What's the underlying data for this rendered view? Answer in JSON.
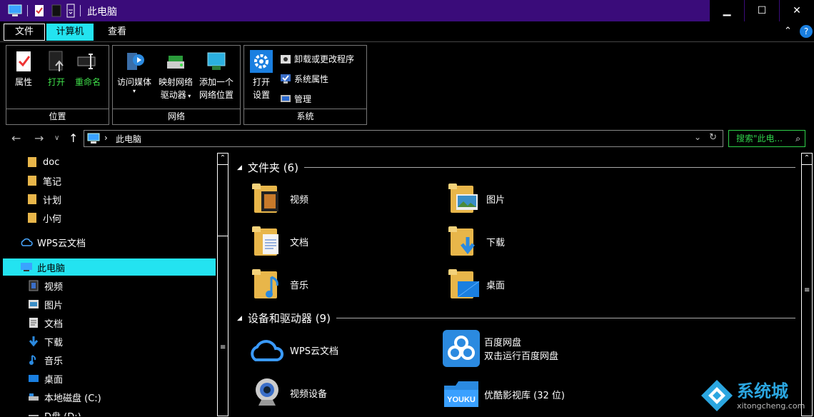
{
  "window": {
    "title": "此电脑",
    "minimize_label": "▁",
    "maximize_label": "☐",
    "close_label": "✕"
  },
  "tabs": {
    "file": "文件",
    "computer": "计算机",
    "view": "查看"
  },
  "ribbon": {
    "location": {
      "label": "位置",
      "properties": "属性",
      "open": "打开",
      "rename": "重命名"
    },
    "network": {
      "label": "网络",
      "access_media": "访问媒体",
      "map_drive_1": "映射网络",
      "map_drive_2": "驱动器",
      "add_location_1": "添加一个",
      "add_location_2": "网络位置"
    },
    "system": {
      "label": "系统",
      "open_settings_1": "打开",
      "open_settings_2": "设置",
      "uninstall": "卸载或更改程序",
      "sys_props": "系统属性",
      "manage": "管理"
    }
  },
  "address": {
    "path": "此电脑",
    "search_placeholder": "搜索\"此电..."
  },
  "sidebar": {
    "items": [
      {
        "label": "doc",
        "icon": "folder-icon"
      },
      {
        "label": "笔记",
        "icon": "folder-icon"
      },
      {
        "label": "计划",
        "icon": "folder-icon"
      },
      {
        "label": "小何",
        "icon": "folder-icon"
      },
      {
        "label": "WPS云文档",
        "icon": "cloud-icon"
      },
      {
        "label": "此电脑",
        "icon": "computer-icon"
      },
      {
        "label": "视频",
        "icon": "video-icon"
      },
      {
        "label": "图片",
        "icon": "picture-icon"
      },
      {
        "label": "文档",
        "icon": "document-icon"
      },
      {
        "label": "下载",
        "icon": "download-icon"
      },
      {
        "label": "音乐",
        "icon": "music-icon"
      },
      {
        "label": "桌面",
        "icon": "desktop-icon"
      },
      {
        "label": "本地磁盘 (C:)",
        "icon": "drive-icon"
      },
      {
        "label": "D盘 (D:)",
        "icon": "drive-icon"
      }
    ]
  },
  "main": {
    "folders_header": "文件夹 (6)",
    "folders": [
      {
        "label": "视频"
      },
      {
        "label": "图片"
      },
      {
        "label": "文档"
      },
      {
        "label": "下载"
      },
      {
        "label": "音乐"
      },
      {
        "label": "桌面"
      }
    ],
    "devices_header": "设备和驱动器 (9)",
    "devices": [
      {
        "label": "WPS云文档",
        "sub": ""
      },
      {
        "label": "百度网盘",
        "sub": "双击运行百度网盘"
      },
      {
        "label": "视频设备",
        "sub": ""
      },
      {
        "label": "优酷影视库 (32 位)",
        "sub": ""
      }
    ]
  },
  "watermark": {
    "brand": "系统城",
    "site": "xitongcheng.com"
  },
  "colors": {
    "title_bar": "#3a0c7a",
    "accent": "#23e3f0",
    "green_text": "#3fe04a"
  }
}
